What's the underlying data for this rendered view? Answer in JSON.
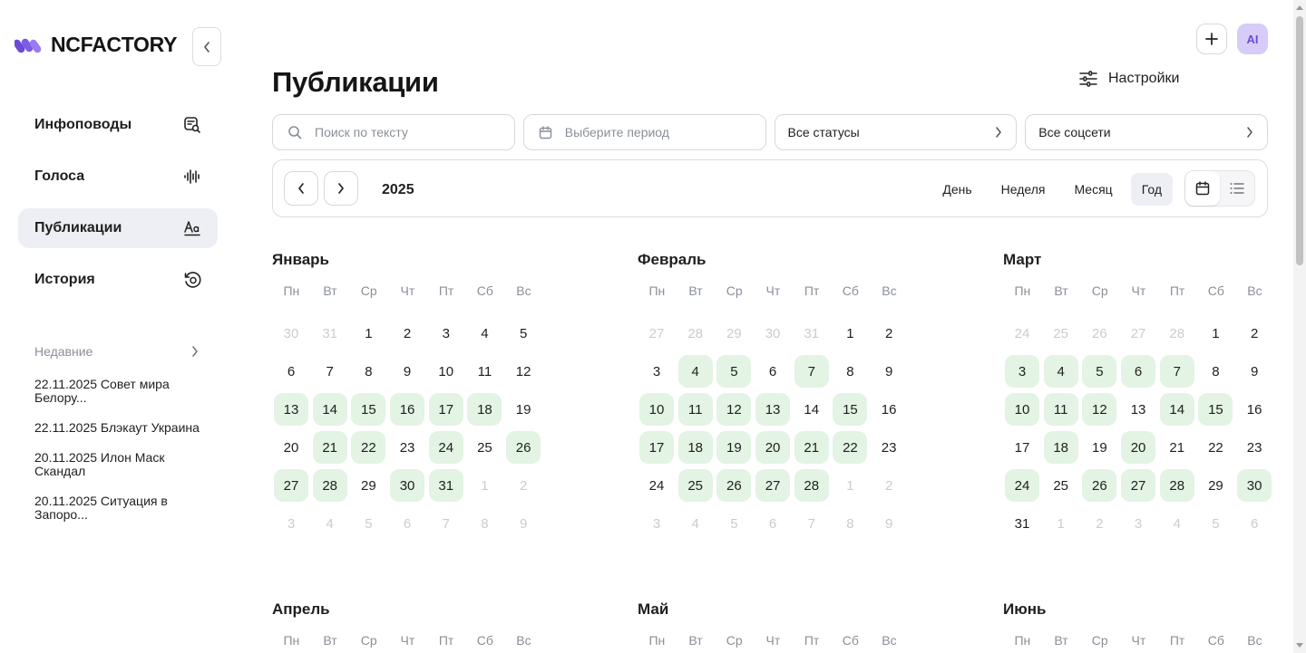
{
  "app": {
    "logo_text": "NCFACTORY"
  },
  "sidebar": {
    "items": [
      {
        "label": "Инфоповоды",
        "icon": "news-search-icon",
        "active": false
      },
      {
        "label": "Голоса",
        "icon": "waveform-icon",
        "active": false
      },
      {
        "label": "Публикации",
        "icon": "text-format-icon",
        "active": true
      },
      {
        "label": "История",
        "icon": "history-icon",
        "active": false
      }
    ],
    "recent_label": "Недавние",
    "recent": [
      {
        "line1": "22.11.2025 Совет мира",
        "line2": "Белору..."
      },
      {
        "line1": "22.11.2025 Блэкаут Украина",
        "line2": ""
      },
      {
        "line1": "20.11.2025 Илон Маск",
        "line2": "Скандал"
      },
      {
        "line1": "20.11.2025 Ситуация в",
        "line2": "Запоро..."
      }
    ]
  },
  "header": {
    "title": "Публикации",
    "settings_label": "Настройки",
    "ai_label": "AI"
  },
  "filters": {
    "search_placeholder": "Поиск по тексту",
    "period_placeholder": "Выберите период",
    "status_value": "Все статусы",
    "social_value": "Все соцсети"
  },
  "toolbar": {
    "year": "2025",
    "views": [
      "День",
      "Неделя",
      "Месяц",
      "Год"
    ],
    "active_view": "Год"
  },
  "weekdays": [
    "Пн",
    "Вт",
    "Ср",
    "Чт",
    "Пт",
    "Сб",
    "Вс"
  ],
  "colors": {
    "published_bg": "#e3f3e4",
    "active_nav_bg": "#eeeff4",
    "ai_bg": "#d6ccf7"
  },
  "months": [
    {
      "name": "Январь",
      "days": [
        {
          "d": "30",
          "o": true
        },
        {
          "d": "31",
          "o": true
        },
        {
          "d": "1"
        },
        {
          "d": "2"
        },
        {
          "d": "3"
        },
        {
          "d": "4"
        },
        {
          "d": "5"
        },
        {
          "d": "6"
        },
        {
          "d": "7"
        },
        {
          "d": "8"
        },
        {
          "d": "9"
        },
        {
          "d": "10"
        },
        {
          "d": "11"
        },
        {
          "d": "12"
        },
        {
          "d": "13",
          "p": true
        },
        {
          "d": "14",
          "p": true
        },
        {
          "d": "15",
          "p": true
        },
        {
          "d": "16",
          "p": true
        },
        {
          "d": "17",
          "p": true
        },
        {
          "d": "18",
          "p": true
        },
        {
          "d": "19"
        },
        {
          "d": "20"
        },
        {
          "d": "21",
          "p": true
        },
        {
          "d": "22",
          "p": true
        },
        {
          "d": "23"
        },
        {
          "d": "24",
          "p": true
        },
        {
          "d": "25"
        },
        {
          "d": "26",
          "p": true
        },
        {
          "d": "27",
          "p": true
        },
        {
          "d": "28",
          "p": true
        },
        {
          "d": "29"
        },
        {
          "d": "30",
          "p": true
        },
        {
          "d": "31",
          "p": true
        },
        {
          "d": "1",
          "o": true
        },
        {
          "d": "2",
          "o": true
        },
        {
          "d": "3",
          "o": true
        },
        {
          "d": "4",
          "o": true
        },
        {
          "d": "5",
          "o": true
        },
        {
          "d": "6",
          "o": true
        },
        {
          "d": "7",
          "o": true
        },
        {
          "d": "8",
          "o": true
        },
        {
          "d": "9",
          "o": true
        }
      ]
    },
    {
      "name": "Февраль",
      "days": [
        {
          "d": "27",
          "o": true
        },
        {
          "d": "28",
          "o": true
        },
        {
          "d": "29",
          "o": true
        },
        {
          "d": "30",
          "o": true
        },
        {
          "d": "31",
          "o": true
        },
        {
          "d": "1"
        },
        {
          "d": "2"
        },
        {
          "d": "3"
        },
        {
          "d": "4",
          "p": true
        },
        {
          "d": "5",
          "p": true
        },
        {
          "d": "6"
        },
        {
          "d": "7",
          "p": true
        },
        {
          "d": "8"
        },
        {
          "d": "9"
        },
        {
          "d": "10",
          "p": true
        },
        {
          "d": "11",
          "p": true
        },
        {
          "d": "12",
          "p": true
        },
        {
          "d": "13",
          "p": true
        },
        {
          "d": "14"
        },
        {
          "d": "15",
          "p": true
        },
        {
          "d": "16"
        },
        {
          "d": "17",
          "p": true
        },
        {
          "d": "18",
          "p": true
        },
        {
          "d": "19",
          "p": true
        },
        {
          "d": "20",
          "p": true
        },
        {
          "d": "21",
          "p": true
        },
        {
          "d": "22",
          "p": true
        },
        {
          "d": "23"
        },
        {
          "d": "24"
        },
        {
          "d": "25",
          "p": true
        },
        {
          "d": "26",
          "p": true
        },
        {
          "d": "27",
          "p": true
        },
        {
          "d": "28",
          "p": true
        },
        {
          "d": "1",
          "o": true
        },
        {
          "d": "2",
          "o": true
        },
        {
          "d": "3",
          "o": true
        },
        {
          "d": "4",
          "o": true
        },
        {
          "d": "5",
          "o": true
        },
        {
          "d": "6",
          "o": true
        },
        {
          "d": "7",
          "o": true
        },
        {
          "d": "8",
          "o": true
        },
        {
          "d": "9",
          "o": true
        }
      ]
    },
    {
      "name": "Март",
      "days": [
        {
          "d": "24",
          "o": true
        },
        {
          "d": "25",
          "o": true
        },
        {
          "d": "26",
          "o": true
        },
        {
          "d": "27",
          "o": true
        },
        {
          "d": "28",
          "o": true
        },
        {
          "d": "1"
        },
        {
          "d": "2"
        },
        {
          "d": "3",
          "p": true
        },
        {
          "d": "4",
          "p": true
        },
        {
          "d": "5",
          "p": true
        },
        {
          "d": "6",
          "p": true
        },
        {
          "d": "7",
          "p": true
        },
        {
          "d": "8"
        },
        {
          "d": "9"
        },
        {
          "d": "10",
          "p": true
        },
        {
          "d": "11",
          "p": true
        },
        {
          "d": "12",
          "p": true
        },
        {
          "d": "13"
        },
        {
          "d": "14",
          "p": true
        },
        {
          "d": "15",
          "p": true
        },
        {
          "d": "16"
        },
        {
          "d": "17"
        },
        {
          "d": "18",
          "p": true
        },
        {
          "d": "19"
        },
        {
          "d": "20",
          "p": true
        },
        {
          "d": "21"
        },
        {
          "d": "22"
        },
        {
          "d": "23"
        },
        {
          "d": "24",
          "p": true
        },
        {
          "d": "25"
        },
        {
          "d": "26",
          "p": true
        },
        {
          "d": "27",
          "p": true
        },
        {
          "d": "28",
          "p": true
        },
        {
          "d": "29"
        },
        {
          "d": "30",
          "p": true
        },
        {
          "d": "31"
        },
        {
          "d": "1",
          "o": true
        },
        {
          "d": "2",
          "o": true
        },
        {
          "d": "3",
          "o": true
        },
        {
          "d": "4",
          "o": true
        },
        {
          "d": "5",
          "o": true
        },
        {
          "d": "6",
          "o": true
        }
      ]
    },
    {
      "name": "Апрель",
      "days": []
    },
    {
      "name": "Май",
      "days": []
    },
    {
      "name": "Июнь",
      "days": []
    }
  ]
}
